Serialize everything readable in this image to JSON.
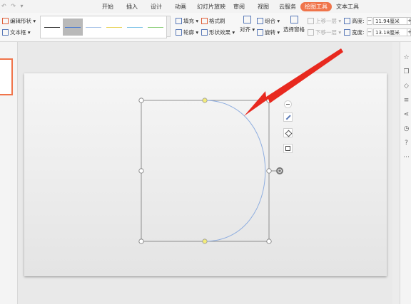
{
  "menubar": {
    "quick_access": "↶ ↷ ▾",
    "items": [
      "开始",
      "插入",
      "设计",
      "动画",
      "幻灯片放映",
      "审阅",
      "视图",
      "云服务",
      "绘图工具",
      "文本工具"
    ],
    "active": "绘图工具"
  },
  "ribbon": {
    "edit_shape": "编辑形状 ▾",
    "textbox": "文本框 ▾",
    "fill": "填充 ▾",
    "format_brush": "格式刷",
    "outline": "轮廓 ▾",
    "shape_effect": "形状效果 ▾",
    "align": "对齐 ▾",
    "group": "组合 ▾",
    "rotate": "旋转 ▾",
    "selection_pane": "选择窗格",
    "bring_forward": "上移一层 ▾",
    "send_backward": "下移一层 ▾",
    "height_label": "高度:",
    "height_value": "11.94厘米",
    "width_label": "宽度:",
    "width_value": "13.18厘米",
    "minus": "−",
    "plus": "+"
  },
  "line_styles": [
    "#333333",
    "#4a7bd0",
    "#a8c4e8",
    "#e8d35a",
    "#7fc4e8",
    "#8ccf7a"
  ],
  "shape": {
    "stroke": "#8faee0",
    "frame": "#777777",
    "handle_yellow": "#f3ec7a"
  },
  "arrow_color": "#e8291f",
  "accent": "#f0744a"
}
